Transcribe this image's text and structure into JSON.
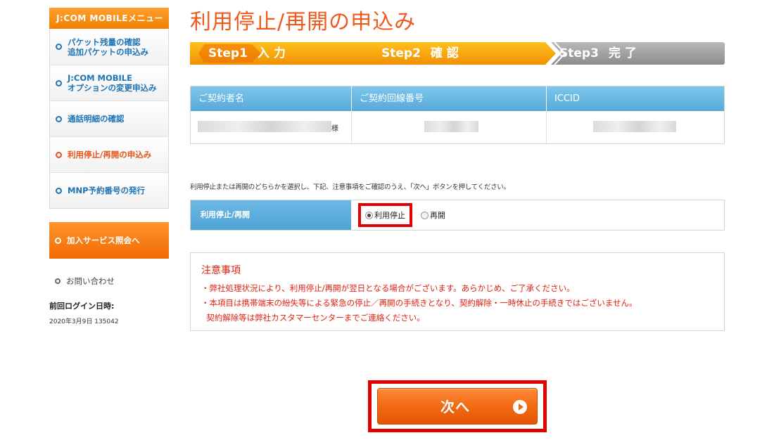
{
  "sidebar": {
    "header": "J:COM MOBILEメニュー",
    "items": [
      {
        "label": "パケット残量の確認\n追加パケットの申込み",
        "active": false
      },
      {
        "label": "J:COM MOBILE\nオプションの変更申込み",
        "active": false
      },
      {
        "label": "通話明細の確認",
        "active": false
      },
      {
        "label": "利用停止/再開の申込み",
        "active": true
      },
      {
        "label": "MNP予約番号の発行",
        "active": false
      }
    ],
    "service_button": "加入サービス照会へ",
    "contact": "お問い合わせ",
    "last_login_label": "前回ログイン日時:",
    "last_login_value": "2020年3月9日 135042"
  },
  "page_title": "利用停止/再開の申込み",
  "steps": [
    {
      "num": "Step1",
      "label": "入力",
      "current": true
    },
    {
      "num": "Step2",
      "label": "確認",
      "current": false
    },
    {
      "num": "Step3",
      "label": "完了",
      "current": false
    }
  ],
  "contract_table": {
    "headers": [
      "ご契約者名",
      "ご契約回線番号",
      "ICCID"
    ],
    "name_suffix": "様"
  },
  "instruction": "利用停止または再開のどちらかを選択し、下記、注意事項をご確認のうえ、「次へ」ボタンを押してください。",
  "status": {
    "label": "利用停止/再開",
    "options": [
      {
        "label": "利用停止",
        "selected": true
      },
      {
        "label": "再開",
        "selected": false
      }
    ]
  },
  "notice": {
    "title": "注意事項",
    "lines": [
      "・弊社処理状況により、利用停止/再開が翌日となる場合がございます。あらかじめ、ご了承ください。",
      "・本項目は携帯端末の紛失等による緊急の停止／再開の手続きとなり、契約解除・一時休止の手続きではございません。",
      "  契約解除等は弊社カスタマーセンターまでご連絡ください。"
    ]
  },
  "next_button": "次へ",
  "colors": {
    "accent": "#ee5a1c",
    "step_current": "#f5a000",
    "step_inactive": "#9a9a9a",
    "table_header": "#63b2e0",
    "highlight_frame": "#e20000"
  }
}
